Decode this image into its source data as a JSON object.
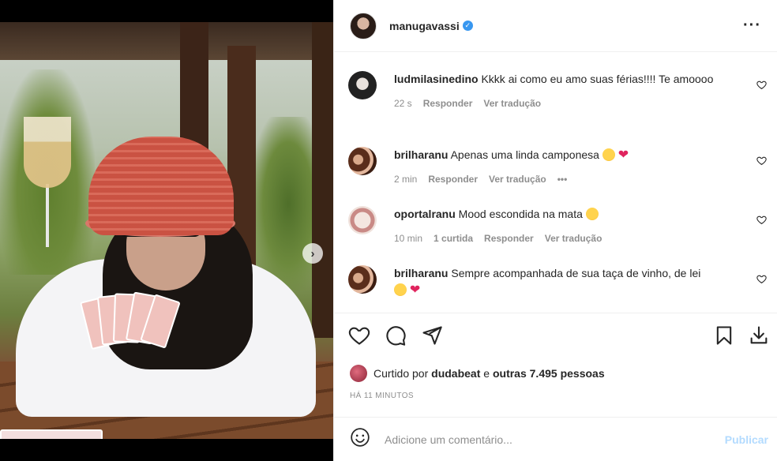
{
  "post": {
    "image_alt": "",
    "carousel": {
      "dots": 4,
      "active": 1
    }
  },
  "header": {
    "username": "manugavassi",
    "verified": true,
    "more_icon": "more-horizontal-icon"
  },
  "comments": [
    {
      "user": "ludmilasinedino",
      "text": "Kkkk ai como eu amo suas férias!!!! Te amoooo",
      "time": "22 s",
      "reply": "Responder",
      "translate": "Ver tradução"
    },
    {
      "user": "brilharanu",
      "text": "Apenas uma linda camponesa",
      "emojis": [
        "laughing-face",
        "red-heart"
      ],
      "time": "2 min",
      "reply": "Responder",
      "translate": "Ver tradução",
      "options": "•••"
    },
    {
      "user": "oportalranu",
      "text": "Mood escondida na mata",
      "emojis": [
        "laughing-face"
      ],
      "time": "10 min",
      "likes": "1 curtida",
      "reply": "Responder",
      "translate": "Ver tradução"
    },
    {
      "user": "brilharanu",
      "text": "Sempre acompanhada de sua taça de vinho, de lei",
      "emojis": [
        "laughing-face",
        "red-heart"
      ]
    }
  ],
  "actions": {
    "like_icon": "heart-icon",
    "comment_icon": "comment-icon",
    "share_icon": "send-icon",
    "save_icon": "bookmark-icon",
    "download_icon": "download-icon"
  },
  "likes": {
    "prefix": "Curtido por",
    "user": "dudabeat",
    "connector": "e",
    "others": "outras 7.495 pessoas"
  },
  "timestamp": "HÁ 11 MINUTOS",
  "add_comment": {
    "placeholder": "Adicione um comentário...",
    "publish": "Publicar"
  },
  "colors": {
    "verified": "#3897f0",
    "publish_disabled": "#b3dbff",
    "meta_text": "#8e8e8e"
  }
}
